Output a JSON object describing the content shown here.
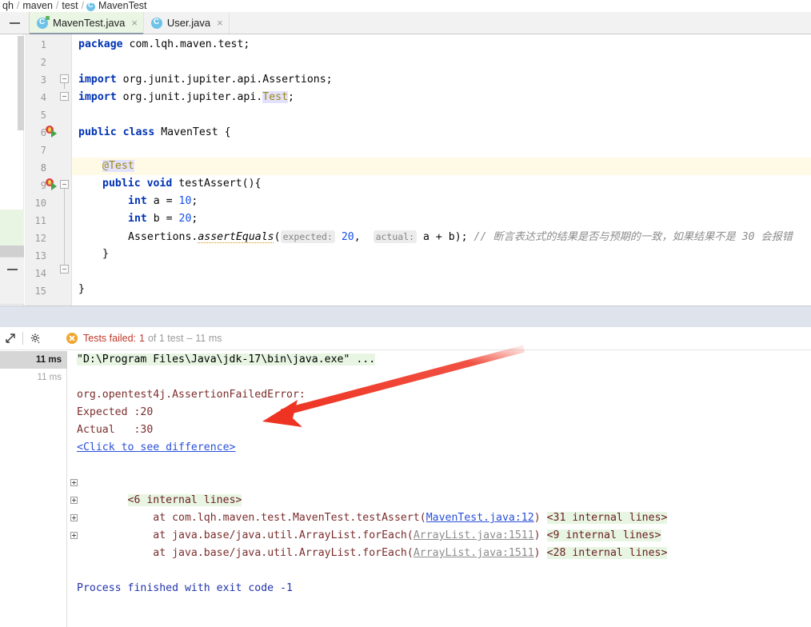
{
  "breadcrumb": {
    "items": [
      {
        "label": "qh",
        "icon": null
      },
      {
        "label": "maven",
        "icon": null
      },
      {
        "label": "test",
        "icon": null
      },
      {
        "label": "MavenTest",
        "icon": "java-class-icon"
      }
    ],
    "separator": "/"
  },
  "tabs": {
    "collapse_icon": "collapse-icon",
    "items": [
      {
        "label": "MavenTest.java",
        "icon": "java-test-class-icon",
        "close": "×",
        "active": true
      },
      {
        "label": "User.java",
        "icon": "java-class-icon",
        "close": "×",
        "active": false
      }
    ]
  },
  "editor": {
    "lines": [
      {
        "n": "1",
        "marks": [],
        "tokens": [
          {
            "t": "package",
            "c": "kw"
          },
          {
            "t": " com.lqh.maven.test;",
            "c": "pl"
          }
        ]
      },
      {
        "n": "2",
        "marks": [],
        "tokens": []
      },
      {
        "n": "3",
        "marks": [
          "fold-open"
        ],
        "tokens": [
          {
            "t": "import",
            "c": "kw"
          },
          {
            "t": " org.junit.jupiter.api.Assertions;",
            "c": "pl"
          }
        ]
      },
      {
        "n": "4",
        "marks": [
          "fold-close"
        ],
        "tokens": [
          {
            "t": "import",
            "c": "kw"
          },
          {
            "t": " org.junit.jupiter.api.",
            "c": "pl"
          },
          {
            "t": "Test",
            "c": "testhl"
          },
          {
            "t": ";",
            "c": "pl"
          }
        ]
      },
      {
        "n": "5",
        "marks": [],
        "tokens": []
      },
      {
        "n": "6",
        "marks": [
          "run"
        ],
        "tokens": [
          {
            "t": "public class",
            "c": "kw"
          },
          {
            "t": " MavenTest {",
            "c": "pl"
          }
        ]
      },
      {
        "n": "7",
        "marks": [],
        "tokens": []
      },
      {
        "n": "8",
        "marks": [
          "rowhl"
        ],
        "tokens": [
          {
            "t": "@Test",
            "c": "testhl"
          }
        ]
      },
      {
        "n": "9",
        "marks": [
          "run",
          "fold-open"
        ],
        "tokens": [
          {
            "t": "public void",
            "c": "kw"
          },
          {
            "t": " testAssert(){",
            "c": "pl"
          }
        ]
      },
      {
        "n": "10",
        "marks": [],
        "tokens": [
          {
            "t": "int",
            "c": "kw"
          },
          {
            "t": " a = ",
            "c": "pl"
          },
          {
            "t": "10",
            "c": "num"
          },
          {
            "t": ";",
            "c": "pl"
          }
        ]
      },
      {
        "n": "11",
        "marks": [],
        "tokens": [
          {
            "t": "int",
            "c": "kw"
          },
          {
            "t": " b = ",
            "c": "pl"
          },
          {
            "t": "20",
            "c": "num"
          },
          {
            "t": ";",
            "c": "pl"
          }
        ]
      },
      {
        "n": "12",
        "marks": [],
        "tokens": []
      },
      {
        "n": "13",
        "marks": [
          "fold-end"
        ],
        "tokens": [
          {
            "t": "}",
            "c": "pl"
          }
        ]
      },
      {
        "n": "14",
        "marks": [],
        "tokens": []
      },
      {
        "n": "15",
        "marks": [],
        "tokens": [
          {
            "t": "}",
            "c": "pl"
          }
        ]
      }
    ],
    "line12": {
      "prefix": "Assertions.",
      "method": "assertEquals",
      "open_paren": "(",
      "hint_expected": "expected:",
      "value_expected": "20",
      "comma": ",",
      "hint_actual": "actual:",
      "value_actual": "a + b);",
      "comment": "// 断言表达式的结果是否与预期的一致，如果结果不是 30 会报错"
    }
  },
  "run_toolbar": {
    "expand_icon": "expand-window-icon",
    "settings_icon": "gear-icon",
    "status_failed": "Tests failed:",
    "status_count": "1",
    "status_of": "of 1 test",
    "status_dash": "–",
    "status_time": "11 ms",
    "fail_icon": "test-failed-icon"
  },
  "console": {
    "timings": [
      "11 ms",
      "11 ms"
    ],
    "lines": [
      {
        "kind": "cmd",
        "text": "\"D:\\Program Files\\Java\\jdk-17\\bin\\java.exe\" ..."
      },
      {
        "kind": "blank",
        "text": ""
      },
      {
        "kind": "blank",
        "text": ""
      },
      {
        "kind": "err",
        "text": "org.opentest4j.AssertionFailedError:"
      },
      {
        "kind": "err",
        "text": "Expected :20"
      },
      {
        "kind": "err",
        "text": "Actual   :30"
      },
      {
        "kind": "link",
        "text": "<Click to see difference>"
      },
      {
        "kind": "blank",
        "text": ""
      },
      {
        "kind": "blank",
        "text": ""
      },
      {
        "kind": "internal",
        "text": "<6 internal lines>"
      },
      {
        "kind": "stack",
        "prefix": "    at com.lqh.maven.test.MavenTest.testAssert(",
        "link": "MavenTest.java:12",
        "link_dim": false,
        "suffix": ")",
        "internal": "<31 internal lines>"
      },
      {
        "kind": "stack",
        "prefix": "    at java.base/java.util.ArrayList.forEach(",
        "link": "ArrayList.java:1511",
        "link_dim": true,
        "suffix": ")",
        "internal": "<9 internal lines>"
      },
      {
        "kind": "stack",
        "prefix": "    at java.base/java.util.ArrayList.forEach(",
        "link": "ArrayList.java:1511",
        "link_dim": true,
        "suffix": ")",
        "internal": "<28 internal lines>"
      },
      {
        "kind": "blank",
        "text": ""
      },
      {
        "kind": "blank",
        "text": ""
      },
      {
        "kind": "finish",
        "text": "Process finished with exit code -1"
      }
    ]
  },
  "annotation": {
    "arrow_color": "#ee3322",
    "arrow_name": "red-annotation-arrow"
  },
  "colors": {
    "tab_active_bg": "#eaf5e4",
    "keyword": "#0033b3",
    "number": "#1750eb",
    "annotation": "#9e880d",
    "error_text": "#7b2d2d",
    "link": "#2a50d8",
    "console_cmd_bg": "#e7f5e2",
    "caret_row": "#fffae5"
  }
}
